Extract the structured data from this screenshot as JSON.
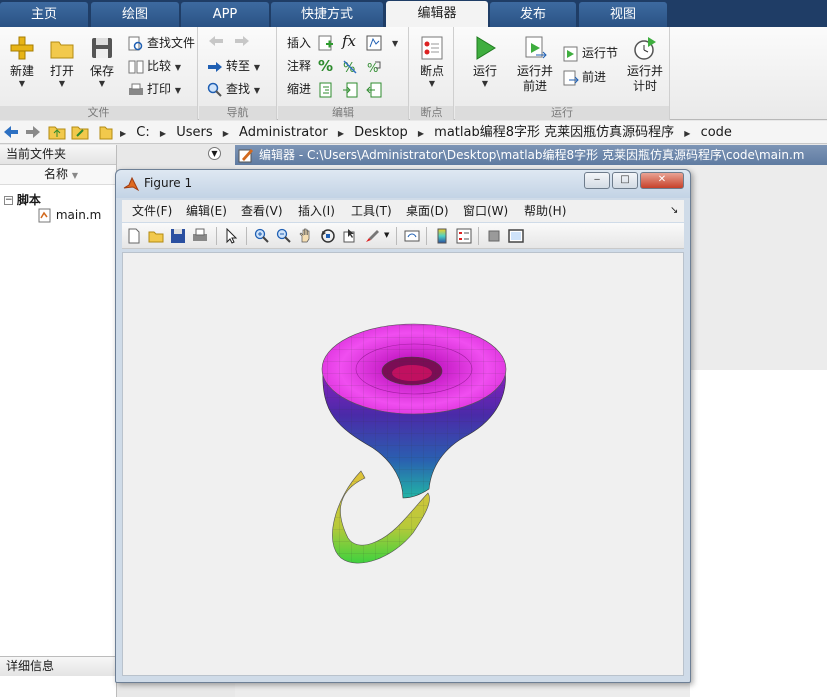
{
  "tabs": [
    "主页",
    "绘图",
    "APP",
    "快捷方式",
    "编辑器",
    "发布",
    "视图"
  ],
  "active_tab": "编辑器",
  "ribbon": {
    "file": {
      "label": "文件",
      "new": "新建",
      "open": "打开",
      "save": "保存",
      "find_files": "查找文件",
      "compare": "比较",
      "print": "打印"
    },
    "navigate": {
      "label": "导航",
      "goto": "转至",
      "find": "查找"
    },
    "edit": {
      "label": "编辑",
      "insert": "插入",
      "comment": "注释",
      "indent": "缩进",
      "fx": "fx"
    },
    "breakpoints": {
      "label": "断点",
      "button": "断点"
    },
    "run": {
      "label": "运行",
      "run": "运行",
      "run_advance_1": "运行并",
      "run_advance_2": "前进",
      "run_section": "运行节",
      "advance": "前进",
      "run_time_1": "运行并",
      "run_time_2": "计时"
    }
  },
  "address": {
    "crumbs": [
      "C:",
      "Users",
      "Administrator",
      "Desktop",
      "matlab编程8字形 克莱因瓶仿真源码程序",
      "code"
    ]
  },
  "left_panel": {
    "title": "当前文件夹",
    "column": "名称",
    "group": "脚本",
    "file": "main.m",
    "details": "详细信息"
  },
  "editor": {
    "title": "编辑器 - C:\\Users\\Administrator\\Desktop\\matlab编程8字形 克莱因瓶仿真源码程序\\code\\main.m"
  },
  "figure": {
    "title": "Figure 1",
    "menu": [
      "文件(F)",
      "编辑(E)",
      "查看(V)",
      "插入(I)",
      "工具(T)",
      "桌面(D)",
      "窗口(W)",
      "帮助(H)"
    ],
    "min": "‒",
    "max": "□",
    "close": "✕"
  },
  "colors": {
    "tabbar": "#1f3d66",
    "accent_magenta": "#e83ee8",
    "accent_purple": "#5b2bb0",
    "accent_teal": "#23b8b0",
    "accent_yellow": "#e3d23a"
  }
}
